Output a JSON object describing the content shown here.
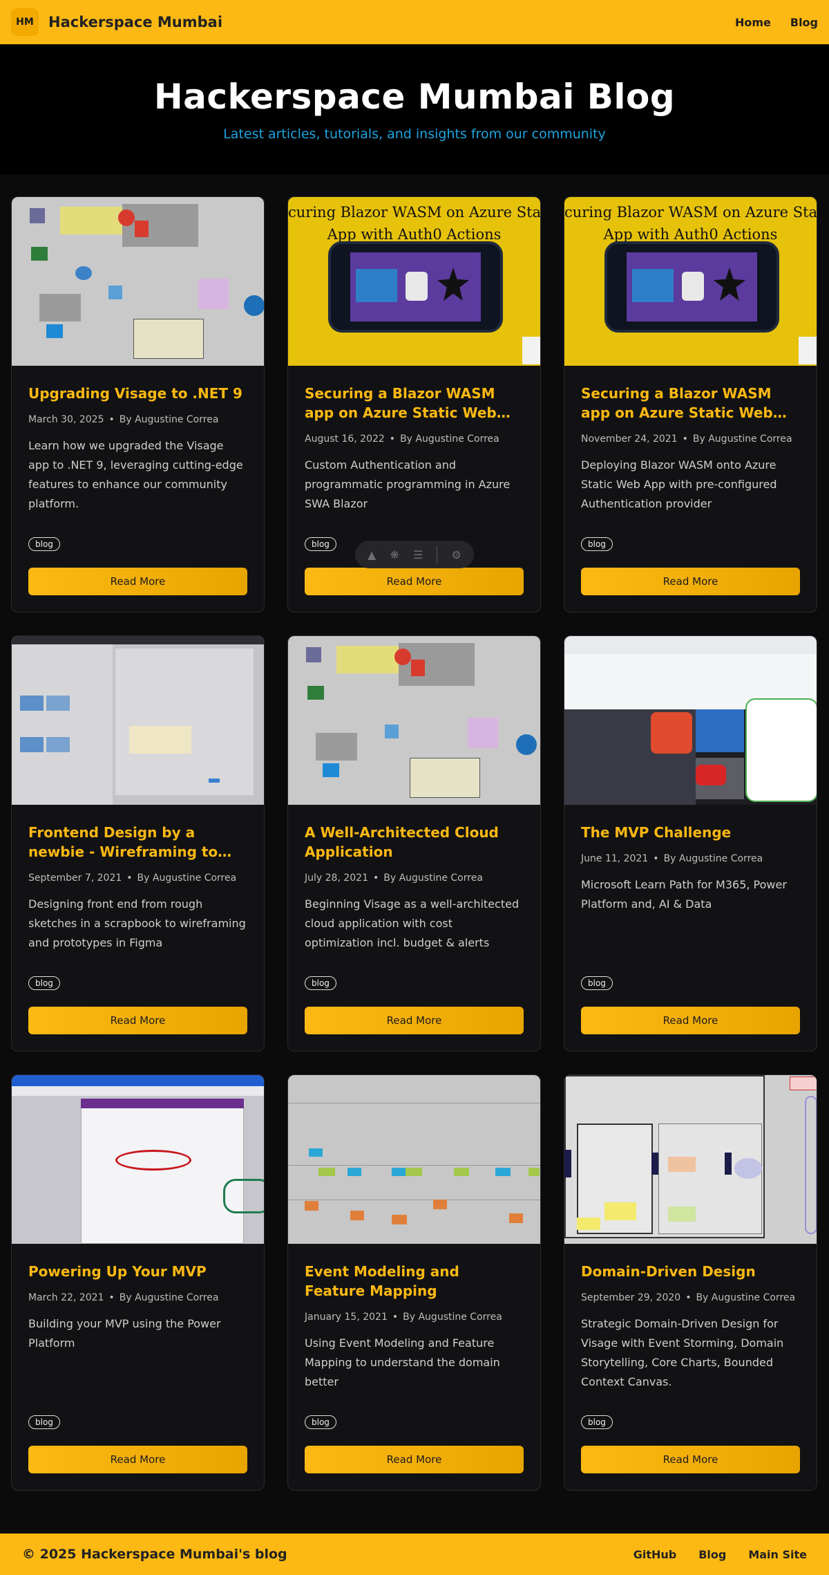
{
  "header": {
    "logo_text": "HM",
    "site_name": "Hackerspace Mumbai",
    "nav": [
      "Home",
      "Blog"
    ]
  },
  "hero": {
    "title": "Hackerspace Mumbai Blog",
    "subtitle": "Latest articles, tutorials, and insights from our community"
  },
  "posts": [
    {
      "title": "Upgrading Visage to .NET 9",
      "date": "March 30, 2025",
      "author": "By Augustine Correa",
      "excerpt": "Learn how we upgraded the Visage app to .NET 9, leveraging cutting-edge features to enhance our community platform.",
      "tag": "blog",
      "button": "Read More"
    },
    {
      "title": "Securing a Blazor WASM app on Azure Static Web Apps",
      "date": "August 16, 2022",
      "author": "By Augustine Correa",
      "excerpt": "Custom Authentication and programmatic programming in Azure SWA Blazor",
      "tag": "blog",
      "button": "Read More",
      "thumb_text": [
        "curing Blazor WASM on Azure Static W",
        "App with Auth0 Actions"
      ]
    },
    {
      "title": "Securing a Blazor WASM app on Azure Static Web Apps",
      "date": "November 24, 2021",
      "author": "By Augustine Correa",
      "excerpt": "Deploying Blazor WASM onto Azure Static Web App with pre-configured Authentication provider",
      "tag": "blog",
      "button": "Read More",
      "thumb_text": [
        "curing Blazor WASM on Azure Static W",
        "App with Auth0 Actions"
      ]
    },
    {
      "title": "Frontend Design by a newbie - Wireframing to Figma",
      "date": "September 7, 2021",
      "author": "By Augustine Correa",
      "excerpt": "Designing front end from rough sketches in a scrapbook to wireframing and prototypes in Figma",
      "tag": "blog",
      "button": "Read More"
    },
    {
      "title": "A Well-Architected Cloud Application",
      "date": "July 28, 2021",
      "author": "By Augustine Correa",
      "excerpt": "Beginning Visage as a well-architected cloud application with cost optimization incl. budget & alerts",
      "tag": "blog",
      "button": "Read More"
    },
    {
      "title": "The MVP Challenge",
      "date": "June 11, 2021",
      "author": "By Augustine Correa",
      "excerpt": "Microsoft Learn Path for M365, Power Platform and, AI & Data",
      "tag": "blog",
      "button": "Read More"
    },
    {
      "title": "Powering Up Your MVP",
      "date": "March 22, 2021",
      "author": "By Augustine Correa",
      "excerpt": "Building your MVP using the Power Platform",
      "tag": "blog",
      "button": "Read More"
    },
    {
      "title": "Event Modeling and Feature Mapping",
      "date": "January 15, 2021",
      "author": "By Augustine Correa",
      "excerpt": "Using Event Modeling and Feature Mapping to understand the domain better",
      "tag": "blog",
      "button": "Read More"
    },
    {
      "title": "Domain-Driven Design",
      "date": "September 29, 2020",
      "author": "By Augustine Correa",
      "excerpt": "Strategic Domain-Driven Design for Visage with Event Storming, Domain Storytelling, Core Charts, Bounded Context Canvas.",
      "tag": "blog",
      "button": "Read More"
    }
  ],
  "floating_toolbar": {
    "icons": [
      "rocket-icon",
      "bug-icon",
      "search-list-icon",
      "gear-icon"
    ]
  },
  "footer": {
    "copyright": "© 2025 Hackerspace Mumbai's blog",
    "links": [
      "GitHub",
      "Blog",
      "Main Site"
    ]
  },
  "colors": {
    "accent": "#fdb913",
    "hero_subtitle": "#1ea5e0",
    "background": "#0b0b0c",
    "card": "#121214"
  }
}
